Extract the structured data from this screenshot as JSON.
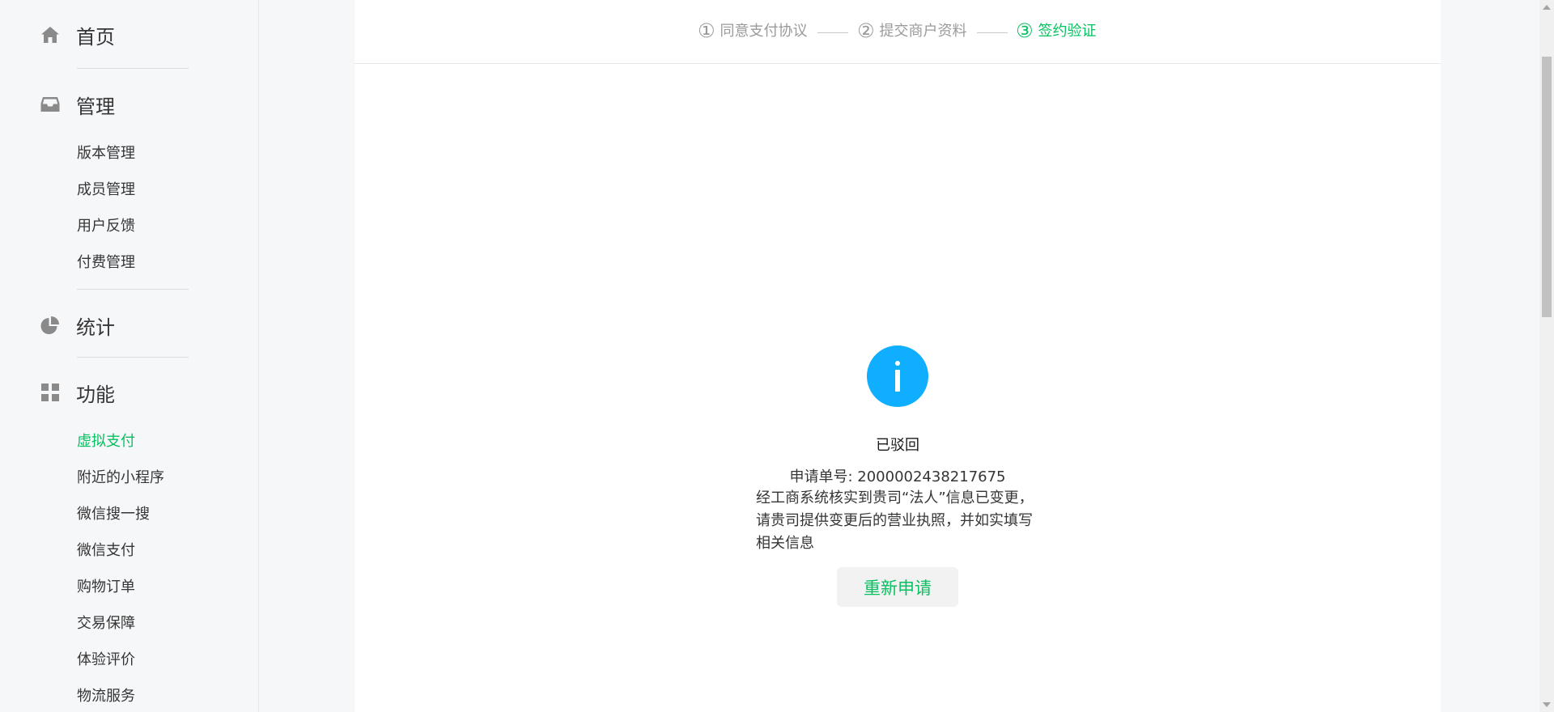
{
  "sidebar": {
    "groups": [
      {
        "label": "首页",
        "icon": "home-icon"
      },
      {
        "label": "管理",
        "icon": "inbox-icon",
        "items": [
          "版本管理",
          "成员管理",
          "用户反馈",
          "付费管理"
        ]
      },
      {
        "label": "统计",
        "icon": "pie-chart-icon"
      },
      {
        "label": "功能",
        "icon": "grid-icon",
        "items": [
          "虚拟支付",
          "附近的小程序",
          "微信搜一搜",
          "微信支付",
          "购物订单",
          "交易保障",
          "体验评价",
          "物流服务"
        ]
      }
    ],
    "active_item": "虚拟支付"
  },
  "steps": [
    {
      "num": "①",
      "label": "同意支付协议"
    },
    {
      "num": "②",
      "label": "提交商户资料"
    },
    {
      "num": "③",
      "label": "签约验证"
    }
  ],
  "result": {
    "icon": "info-icon",
    "title": "已驳回",
    "app_no": "申请单号: 2000002438217675",
    "description": "经工商系统核实到贵司“法人”信息已变更，请贵司提供变更后的营业执照，并如实填写相关信息",
    "button": "重新申请"
  },
  "colors": {
    "accent": "#07c160",
    "info": "#10aeff"
  }
}
